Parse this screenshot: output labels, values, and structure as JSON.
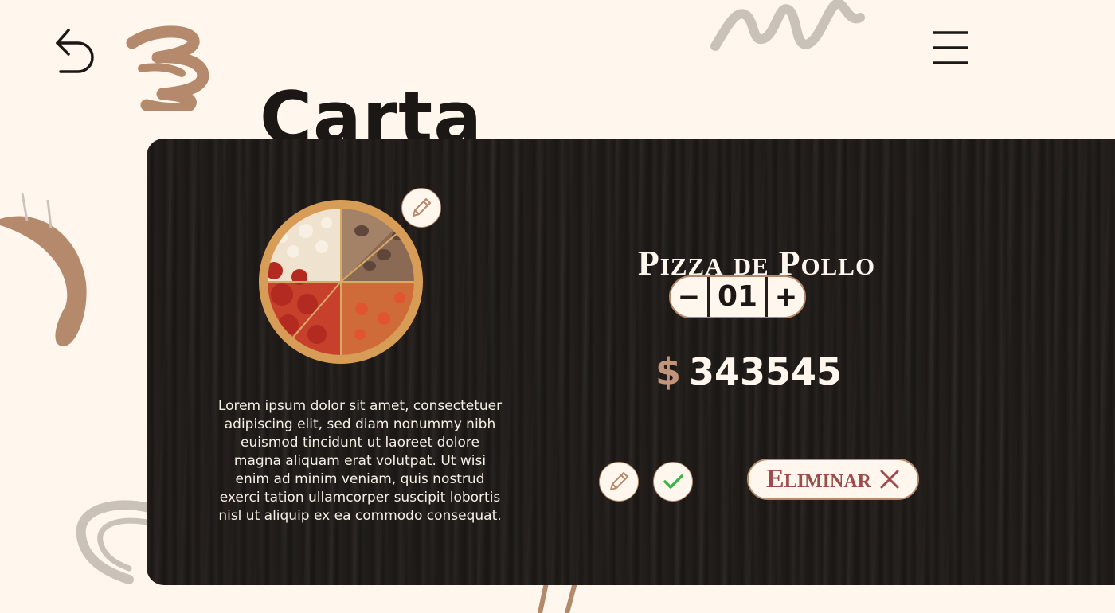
{
  "header": {
    "title": "Carta",
    "back_icon": "back-arrow-icon",
    "menu_icon": "hamburger-menu-icon"
  },
  "product": {
    "name": "Pizza de Pollo",
    "quantity": "01",
    "minus_label": "−",
    "plus_label": "+",
    "currency": "$",
    "price": "343545",
    "description": "Lorem ipsum dolor sit amet, consectetuer adipiscing elit, sed diam nonummy nibh euismod tincidunt ut laoreet dolore magna aliquam erat volutpat. Ut wisi enim ad minim veniam, quis nostrud exerci tation ullamcorper suscipit lobortis nisl ut aliquip ex ea commodo consequat.",
    "image_icon": "pizza-photo"
  },
  "actions": {
    "edit_icon": "pencil-icon",
    "confirm_icon": "check-icon",
    "delete_label": "Eliminar",
    "delete_icon": "close-x-icon"
  },
  "colors": {
    "background": "#fff7ee",
    "card": "#231e1b",
    "accent": "#b58a6c",
    "delete_text": "#9e4b4b",
    "confirm": "#3fb44b"
  }
}
